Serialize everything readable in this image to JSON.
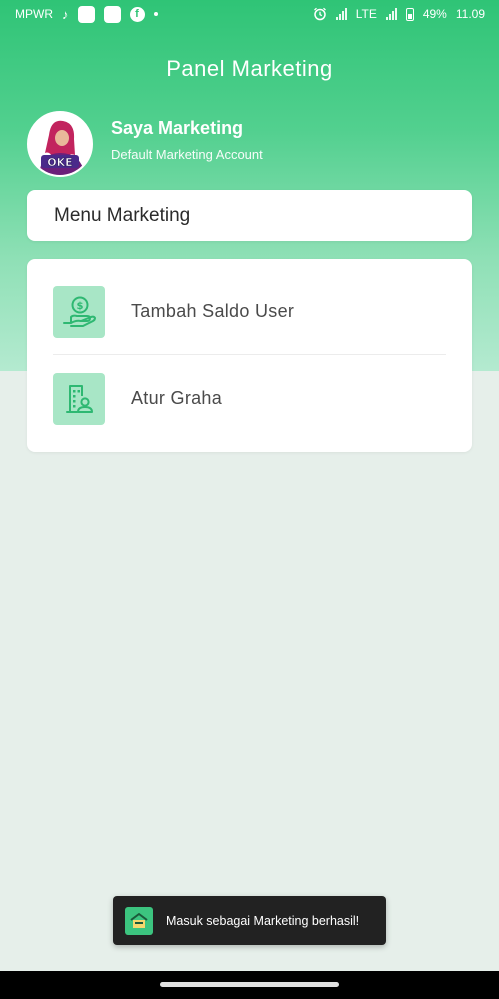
{
  "status_bar": {
    "carrier": "MPWR",
    "network": "LTE",
    "battery": "49%",
    "time": "11.09",
    "icons": [
      "tiktok-icon",
      "app-icon",
      "app-icon",
      "facebook-icon",
      "dot-icon",
      "alarm-icon",
      "signal-icon",
      "signal-icon",
      "battery-icon"
    ]
  },
  "header": {
    "title": "Panel Marketing"
  },
  "profile": {
    "name": "Saya Marketing",
    "subtitle": "Default Marketing Account",
    "avatar_text": "OKE"
  },
  "menu": {
    "header": "Menu Marketing",
    "items": [
      {
        "label": "Tambah Saldo User",
        "icon": "hand-money-icon"
      },
      {
        "label": "Atur Graha",
        "icon": "building-user-icon"
      }
    ]
  },
  "toast": {
    "text": "Masuk sebagai Marketing berhasil!",
    "icon": "app-logo-icon"
  },
  "colors": {
    "primary": "#2fc476",
    "icon_bg": "#a8e6c6",
    "icon_stroke": "#2eb872",
    "background": "#e6efea"
  }
}
